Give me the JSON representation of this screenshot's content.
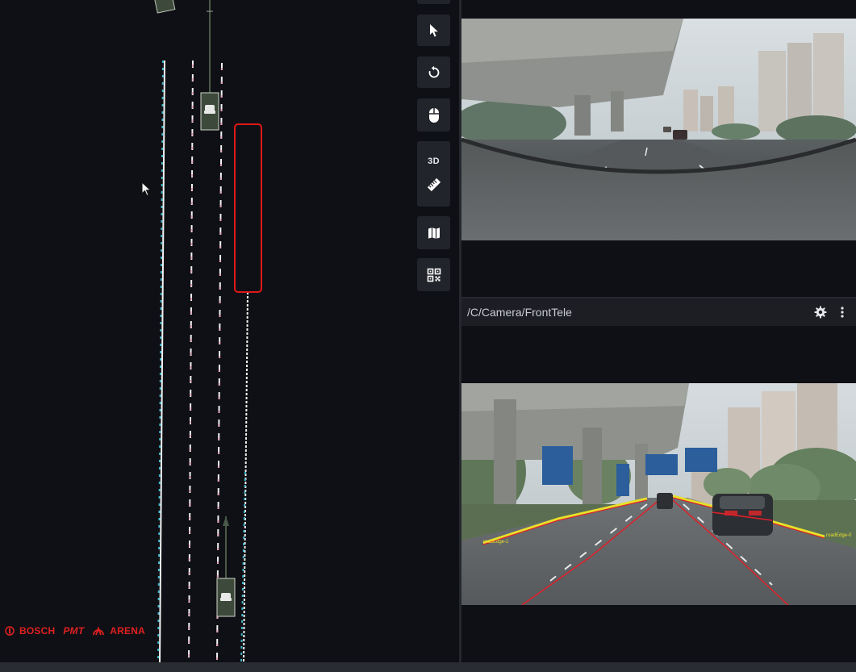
{
  "toolbar": {
    "buttons": [
      {
        "icon": "pointer-icon"
      },
      {
        "icon": "rotate-icon"
      },
      {
        "icon": "mouse-icon"
      },
      {
        "label": "3D",
        "icon": "ruler-icon"
      },
      {
        "icon": "map-icon"
      },
      {
        "icon": "qr-code-icon"
      }
    ]
  },
  "camera_panel": {
    "title": "/C/Camera/FrontTele",
    "settings_icon": "gear-icon",
    "menu_icon": "more-vertical-icon"
  },
  "overlay_labels": {
    "left_edge": "roadEdge-1",
    "right_edge": "roadEdge-0"
  },
  "brand": {
    "bosch": "BOSCH",
    "pmt": "PMT",
    "arena": "ARENA"
  },
  "colors": {
    "background": "#0f1015",
    "panel": "#1c1e24",
    "button": "#22242b",
    "lane_white": "#f2f2f2",
    "lane_pink": "#e7a6b8",
    "lane_cyan": "#3fb6c9",
    "highlight_box": "#e01818",
    "vehicle_fill": "#3d4a3b",
    "road_edge_yellow": "#e6e02a",
    "lane_red": "#e0202a",
    "brand_red": "#e02020"
  }
}
